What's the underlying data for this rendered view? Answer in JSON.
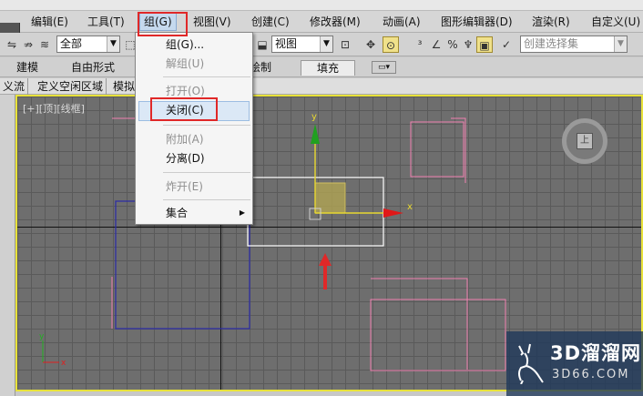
{
  "menubar": {
    "items": [
      {
        "label": "编辑(E)"
      },
      {
        "label": "工具(T)"
      },
      {
        "label": "组(G)"
      },
      {
        "label": "视图(V)"
      },
      {
        "label": "创建(C)"
      },
      {
        "label": "修改器(M)"
      },
      {
        "label": "动画(A)"
      },
      {
        "label": "图形编辑器(D)"
      },
      {
        "label": "渲染(R)"
      },
      {
        "label": "自定义(U)"
      }
    ]
  },
  "toolbar": {
    "selection_filter": "全部",
    "reference_coord": "视图",
    "named_selection_placeholder": "创建选择集"
  },
  "ribbon": {
    "tabs": [
      "建模",
      "自由形式",
      "绘制",
      "填充"
    ],
    "active_tab": "填充"
  },
  "subtabs": [
    "义流",
    "定义空闲区域",
    "模拟"
  ],
  "viewport": {
    "label": "[+][顶][线框]",
    "viewcube_label": "上",
    "axis_x": "x",
    "axis_y": "y"
  },
  "group_menu": {
    "items": [
      {
        "label": "组(G)...",
        "enabled": true
      },
      {
        "label": "解组(U)",
        "enabled": false
      },
      {
        "label": "打开(O)",
        "enabled": false
      },
      {
        "label": "关闭(C)",
        "enabled": true,
        "highlighted": true
      },
      {
        "label": "附加(A)",
        "enabled": false
      },
      {
        "label": "分离(D)",
        "enabled": true
      },
      {
        "label": "炸开(E)",
        "enabled": false
      },
      {
        "label": "集合",
        "enabled": true,
        "submenu": true
      }
    ]
  },
  "watermark": {
    "brand": "3D溜溜网",
    "domain": "3D66.COM"
  },
  "colors": {
    "viewport_border": "#e8e23a",
    "annotation_red": "#e02828",
    "menu_hover": "#dbe8f6"
  }
}
